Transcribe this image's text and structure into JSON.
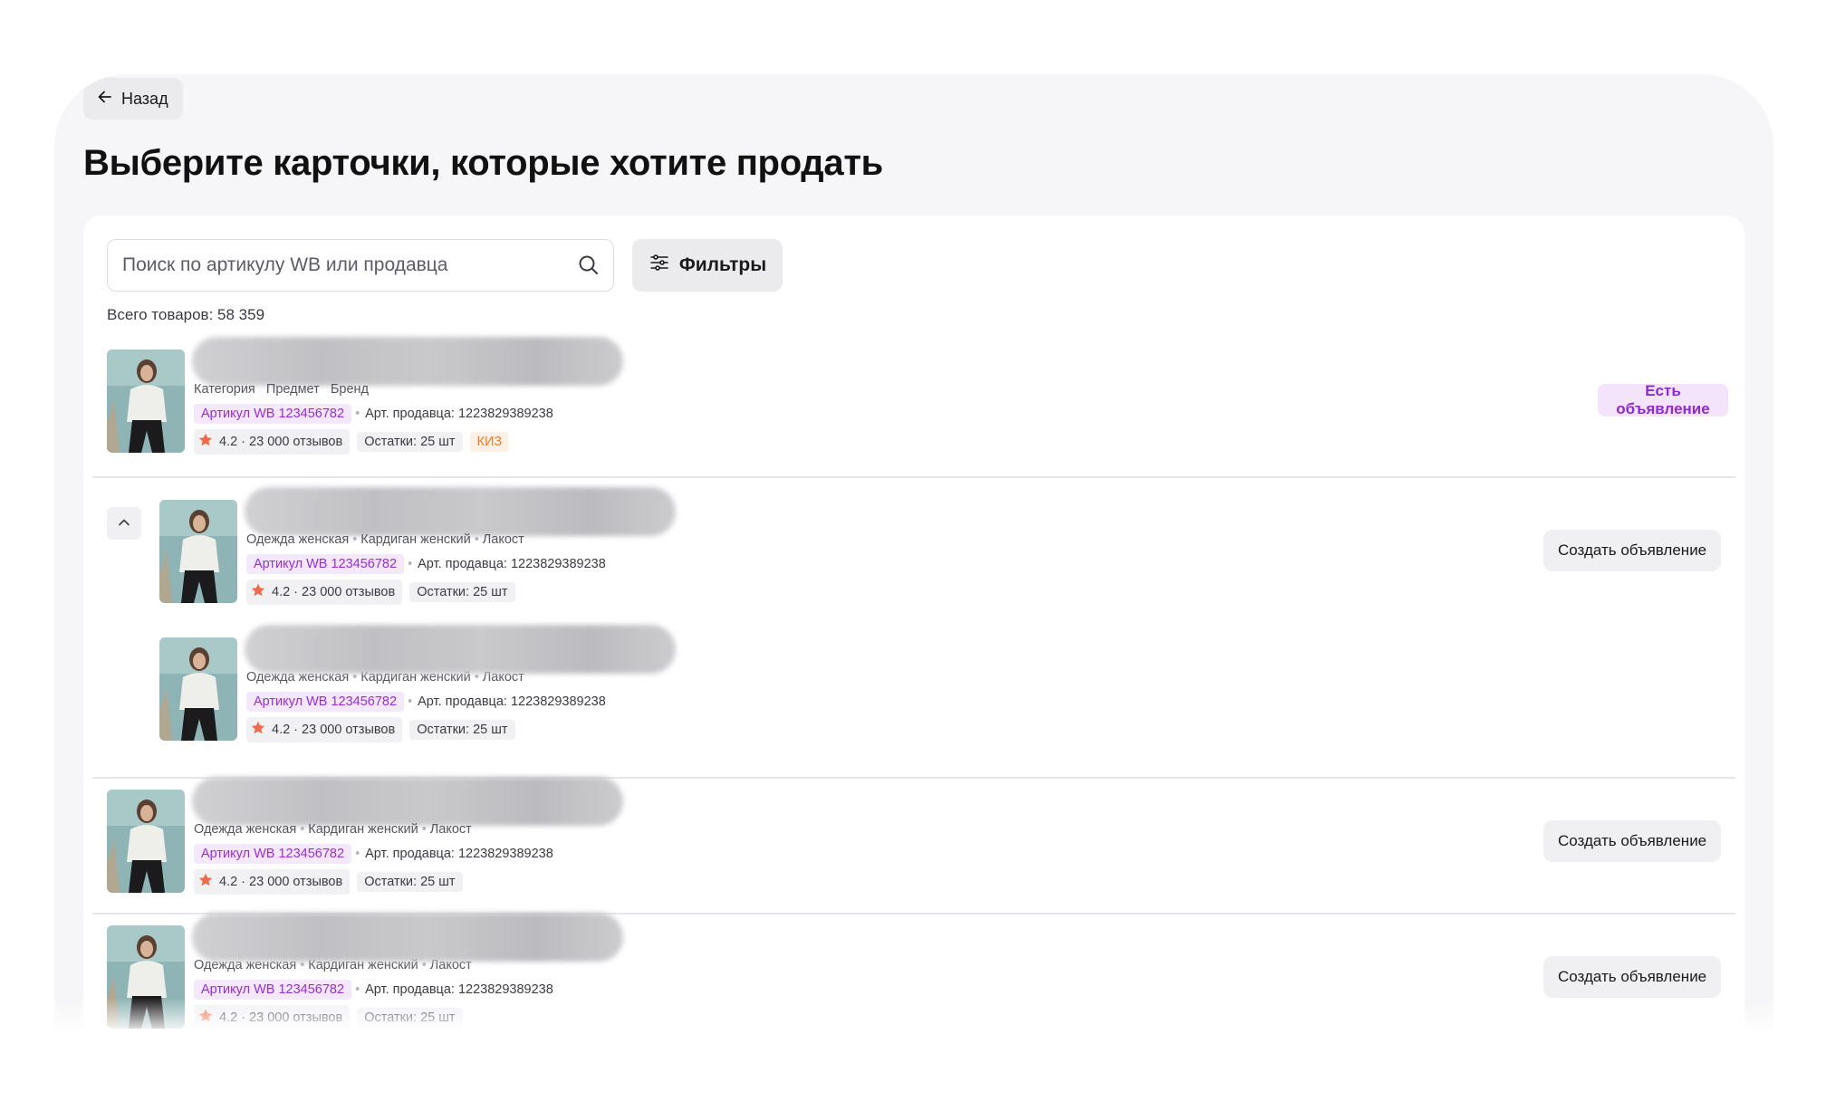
{
  "header": {
    "back_label": "Назад",
    "title": "Выберите карточки, которые хотите продать"
  },
  "search": {
    "placeholder": "Поиск по артикулу WB или продавца",
    "value": ""
  },
  "filters_label": "Фильтры",
  "total_label": "Всего товаров: 58 359",
  "items": [
    {
      "meta": [
        "Категория",
        "Предмет",
        "Бренд"
      ],
      "article": "Артикул WB 123456782",
      "seller_article": "Арт. продавца: 1223829389238",
      "rating": "4.2 · 23 000 отзывов",
      "stock": "Остатки: 25 шт",
      "kiz": "КИЗ",
      "action": "Есть объявление"
    },
    {
      "meta": [
        "Одежда женская",
        "Кардиган женский",
        "Лакост"
      ],
      "article": "Артикул WB 123456782",
      "seller_article": "Арт. продавца: 1223829389238",
      "rating": "4.2 · 23 000 отзывов",
      "stock": "Остатки: 25 шт",
      "action": "Создать объявление"
    },
    {
      "meta": [
        "Одежда женская",
        "Кардиган женский",
        "Лакост"
      ],
      "article": "Артикул WB 123456782",
      "seller_article": "Арт. продавца: 1223829389238",
      "rating": "4.2 · 23 000 отзывов",
      "stock": "Остатки: 25 шт"
    },
    {
      "meta": [
        "Одежда женская",
        "Кардиган женский",
        "Лакост"
      ],
      "article": "Артикул WB 123456782",
      "seller_article": "Арт. продавца: 1223829389238",
      "rating": "4.2 · 23 000 отзывов",
      "stock": "Остатки: 25 шт",
      "action": "Создать объявление"
    },
    {
      "meta": [
        "Одежда женская",
        "Кардиган женский",
        "Лакост"
      ],
      "article": "Артикул WB 123456782",
      "seller_article": "Арт. продавца: 1223829389238",
      "rating": "4.2 · 23 000 отзывов",
      "stock": "Остатки: 25 шт",
      "action": "Создать объявление"
    }
  ],
  "colors": {
    "accent": "#9b2bd6",
    "star": "#f06a4a",
    "kiz": "#f07a22"
  },
  "icons": [
    "arrow-left-icon",
    "search-icon",
    "filter-sliders-icon",
    "star-icon",
    "chevron-up-icon"
  ]
}
